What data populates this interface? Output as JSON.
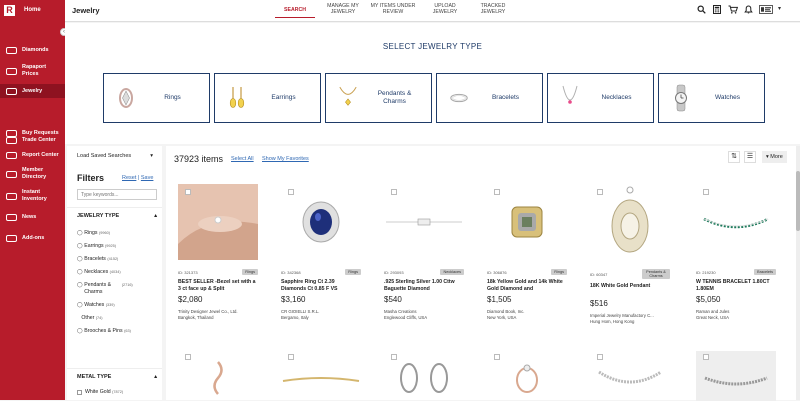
{
  "sidebar": {
    "logo": "R",
    "items": [
      {
        "label": "Home",
        "icon": "home-icon"
      },
      {
        "label": "Diamonds",
        "icon": "diamond-icon"
      },
      {
        "label": "Rapaport Prices",
        "icon": "price-icon"
      },
      {
        "label": "Jewelry",
        "icon": "jewelry-icon"
      },
      {
        "label": "Trade Center",
        "icon": "trade-icon"
      },
      {
        "label": "Buy Requests",
        "icon": "buy-request-icon"
      },
      {
        "label": "Report Center",
        "icon": "report-icon"
      },
      {
        "label": "Member Directory",
        "icon": "directory-icon"
      },
      {
        "label": "Instant Inventory",
        "icon": "inventory-icon"
      },
      {
        "label": "News",
        "icon": "news-icon"
      },
      {
        "label": "Add-ons",
        "icon": "addons-icon"
      }
    ],
    "active": "Jewelry",
    "collapse_glyph": "‹"
  },
  "topbar": {
    "title": "Jewelry",
    "tabs": [
      "SEARCH",
      "MANAGE MY JEWELRY",
      "MY ITEMS UNDER REVIEW",
      "UPLOAD JEWELRY",
      "TRACKED JEWELRY"
    ],
    "active_tab": "SEARCH"
  },
  "select": {
    "title": "SELECT JEWELRY TYPE",
    "types": [
      "Rings",
      "Earrings",
      "Pendants & Charms",
      "Bracelets",
      "Necklaces",
      "Watches"
    ]
  },
  "filters": {
    "saved_searches": "Load Saved Searches",
    "title": "Filters",
    "reset": "Reset",
    "save": "Save",
    "search_placeholder": "Type keywords...",
    "jewelry_type_header": "JEWELRY TYPE",
    "jewelry_types": [
      {
        "label": "Rings",
        "count": "(9960)"
      },
      {
        "label": "Earrings",
        "count": "(9925)"
      },
      {
        "label": "Bracelets",
        "count": "(4152)"
      },
      {
        "label": "Necklaces",
        "count": "(4034)"
      },
      {
        "label": "Pendants & Charms",
        "count": "(2716)"
      },
      {
        "label": "Watches",
        "count": "(339)"
      },
      {
        "label": "Other",
        "count": "(74)"
      },
      {
        "label": "Brooches & Pins",
        "count": "(63)"
      }
    ],
    "metal_type_header": "METAL TYPE",
    "metal_types": [
      {
        "label": "White Gold",
        "count": "(7872)"
      }
    ]
  },
  "results": {
    "count": "37923 items",
    "select_all": "Select All",
    "show_favorites": "Show My Favorites",
    "more": "More"
  },
  "products": [
    {
      "id": "ID: 321373",
      "type": "Rings",
      "name": "BEST SELLER -Bezel set with a 3 ct face up & Split",
      "price": "$2,080",
      "seller": "Trinity Designer Jewel Co., Ltd.",
      "location": "Bangkok, Thailand"
    },
    {
      "id": "ID: 342368",
      "type": "Rings",
      "name": "Sapphire Ring Ct 2.39 Diamonds Ct 0.85 F VS",
      "price": "$3,160",
      "seller": "CR GIOIELLI S.R.L.",
      "location": "Bergamo, Italy"
    },
    {
      "id": "ID: 293093",
      "type": "Necklaces",
      "name": ".925 Sterling Silver 1.00 Cttw Baguette Diamond",
      "price": "$540",
      "seller": "Masha Creations",
      "location": "Englewood Cliffs, USA"
    },
    {
      "id": "ID: 306876",
      "type": "Rings",
      "name": "18k Yellow Gold and 14k White Gold Diamond and",
      "price": "$1,505",
      "seller": "Diamond Book, Inc.",
      "location": "New York, USA"
    },
    {
      "id": "ID: 60347",
      "type": "Pendants & Charms",
      "name": "18K White Gold Pendant",
      "price": "$516",
      "seller": "Imperial Jewelry Manufactory C...",
      "location": "Hung Hom, Hong Kong"
    },
    {
      "id": "ID: 219230",
      "type": "Bracelets",
      "name": "W TENNIS BRACELET 1.80CT 1.80EM",
      "price": "$5,050",
      "seller": "Raman and Jules",
      "location": "Great Neck, USA"
    }
  ],
  "colors": {
    "brand": "#b71c2b",
    "navy": "#1f3b68",
    "link": "#2f68b3"
  }
}
